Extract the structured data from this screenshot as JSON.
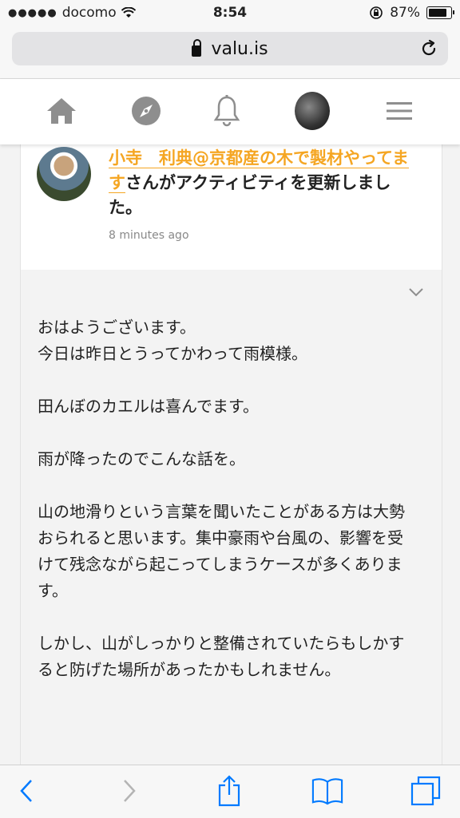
{
  "status": {
    "signal_dots": "●●●●●",
    "carrier": "docomo",
    "time": "8:54",
    "battery": "87%"
  },
  "browser": {
    "url": "valu.is"
  },
  "nav": {
    "icons": [
      "home-icon",
      "compass-icon",
      "bell-icon",
      "avatar",
      "menu-icon"
    ]
  },
  "activity": {
    "user_name": "小寺　利典@京都産の木で製材やってます",
    "action_text": "さんがアクティビティを更新しました。",
    "time": "8 minutes ago"
  },
  "post": {
    "paragraphs": [
      "おはようございます。\n今日は昨日とうってかわって雨模様。",
      "田んぼのカエルは喜んでます。",
      "雨が降ったのでこんな話を。",
      "山の地滑りという言葉を聞いたことがある方は大勢おられると思います。集中豪雨や台風の、影響を受けて残念ながら起こってしまうケースが多くあります。",
      "しかし、山がしっかりと整備されていたらもしかすると防げた場所があったかもしれません。"
    ]
  },
  "colors": {
    "accent": "#f5a623",
    "icon_gray": "#8e8e8e",
    "ios_blue": "#007aff"
  }
}
